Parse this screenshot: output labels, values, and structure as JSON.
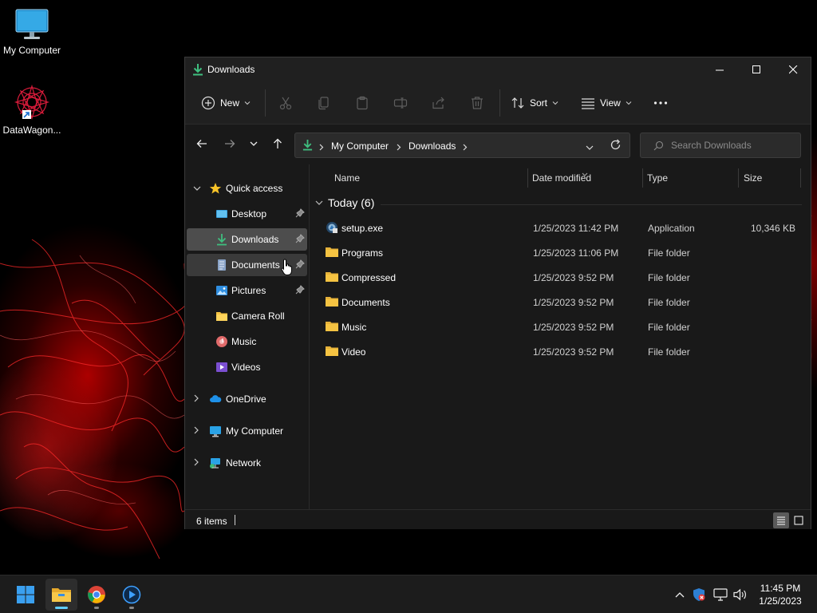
{
  "desktop": {
    "icons": [
      {
        "label": "My Computer",
        "icon": "monitor-icon"
      },
      {
        "label": "DataWagon...",
        "icon": "datawagon-shortcut-icon"
      }
    ]
  },
  "window": {
    "title": "Downloads",
    "toolbar": {
      "new_label": "New",
      "sort_label": "Sort",
      "view_label": "View"
    },
    "address": {
      "crumbs": [
        "My Computer",
        "Downloads"
      ]
    },
    "search": {
      "placeholder": "Search Downloads"
    },
    "sidebar": {
      "quick_access": "Quick access",
      "items": [
        {
          "label": "Desktop",
          "pinned": true
        },
        {
          "label": "Downloads",
          "pinned": true
        },
        {
          "label": "Documents",
          "pinned": true
        },
        {
          "label": "Pictures",
          "pinned": true
        },
        {
          "label": "Camera Roll",
          "pinned": false
        },
        {
          "label": "Music",
          "pinned": false
        },
        {
          "label": "Videos",
          "pinned": false
        }
      ],
      "onedrive": "OneDrive",
      "my_computer": "My Computer",
      "network": "Network"
    },
    "columns": {
      "name": "Name",
      "date": "Date modified",
      "type": "Type",
      "size": "Size"
    },
    "group": "Today (6)",
    "files": [
      {
        "name": "setup.exe",
        "date": "1/25/2023 11:42 PM",
        "type": "Application",
        "size": "10,346 KB"
      },
      {
        "name": "Programs",
        "date": "1/25/2023 11:06 PM",
        "type": "File folder",
        "size": ""
      },
      {
        "name": "Compressed",
        "date": "1/25/2023 9:52 PM",
        "type": "File folder",
        "size": ""
      },
      {
        "name": "Documents",
        "date": "1/25/2023 9:52 PM",
        "type": "File folder",
        "size": ""
      },
      {
        "name": "Music",
        "date": "1/25/2023 9:52 PM",
        "type": "File folder",
        "size": ""
      },
      {
        "name": "Video",
        "date": "1/25/2023 9:52 PM",
        "type": "File folder",
        "size": ""
      }
    ],
    "status": {
      "count": "6 items"
    }
  },
  "taskbar": {
    "time": "11:45 PM",
    "date": "1/25/2023"
  },
  "colors": {
    "accent_green": "#3fbf7f",
    "folder_yellow": "#f5c342",
    "selection": "#4d4d4d"
  }
}
